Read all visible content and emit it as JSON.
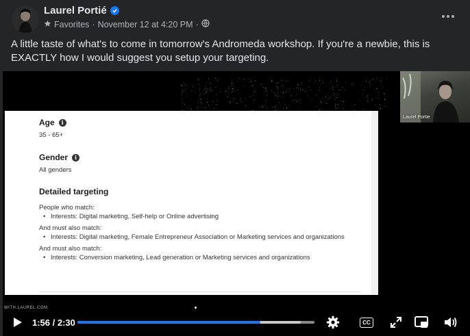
{
  "post": {
    "author": "Laurel Portié",
    "audience": "Favorites",
    "timestamp": "November 12 at 4:20 PM",
    "separator": "·",
    "caption": "A little taste of what's to come in tomorrow's Andromeda workshop. If you're a newbie, this is EXACTLY how I would suggest you setup your targeting."
  },
  "slide": {
    "age_title": "Age",
    "age_value": "35 - 65+",
    "gender_title": "Gender",
    "gender_value": "All genders",
    "targeting_title": "Detailed targeting",
    "groups": [
      {
        "label": "People who match:",
        "bullets": [
          "Interests: Digital marketing, Self-help or Online advertising"
        ]
      },
      {
        "label": "And must also match:",
        "bullets": [
          "Interests: Digital marketing, Female Entrepreneur Association or Marketing services and organizations"
        ]
      },
      {
        "label": "And must also match:",
        "bullets": [
          "Interests: Conversion marketing, Lead generation or Marketing services and organizations"
        ]
      }
    ]
  },
  "pip": {
    "name": "Laurel Portie"
  },
  "watermark": "WITH.LAUREL.COM",
  "player": {
    "time": "1:56 / 2:30",
    "played_fraction": 0.773,
    "buffered_fraction": 0.942,
    "cc_label": "CC"
  },
  "colors": {
    "accent": "#1877f2",
    "background": "#242526"
  },
  "icons": [
    "verified-icon",
    "star-icon",
    "globe-icon",
    "more-icon",
    "info-icon",
    "play-icon",
    "gear-icon",
    "cc-icon",
    "fullscreen-icon",
    "pip-icon",
    "volume-icon"
  ]
}
